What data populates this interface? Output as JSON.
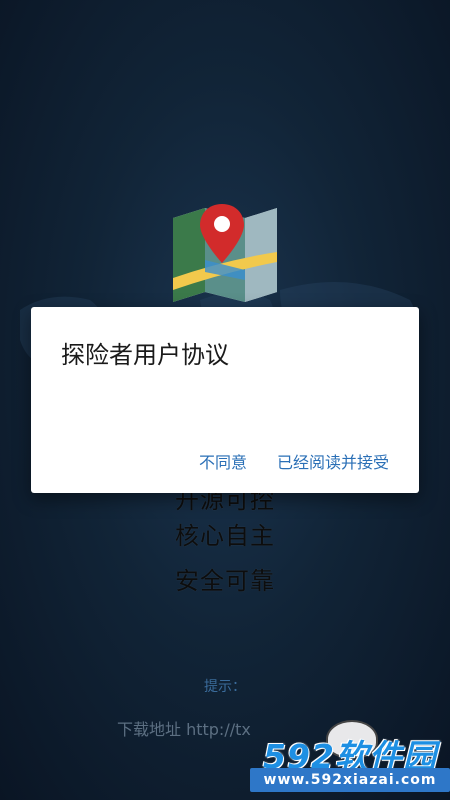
{
  "background": {
    "slogans": [
      "开源可控",
      "核心自主",
      "安全可靠"
    ],
    "hint_label": "提示：",
    "download_text": "下载地址 http://tx"
  },
  "dialog": {
    "title": "探险者用户协议",
    "disagree_label": "不同意",
    "accept_label": "已经阅读并接受"
  },
  "watermark": {
    "brand": "592软件园",
    "url": "www.592xiazai.com"
  },
  "colors": {
    "background_dark": "#0a1524",
    "background_mid": "#1b3550",
    "dialog_bg": "#ffffff",
    "action_blue": "#2a6fb6",
    "pin_red": "#d22b2b",
    "watermark_blue": "#1d8fe3"
  },
  "icons": {
    "app_logo": "map-pin-icon",
    "background_art": "world-map-icon"
  }
}
